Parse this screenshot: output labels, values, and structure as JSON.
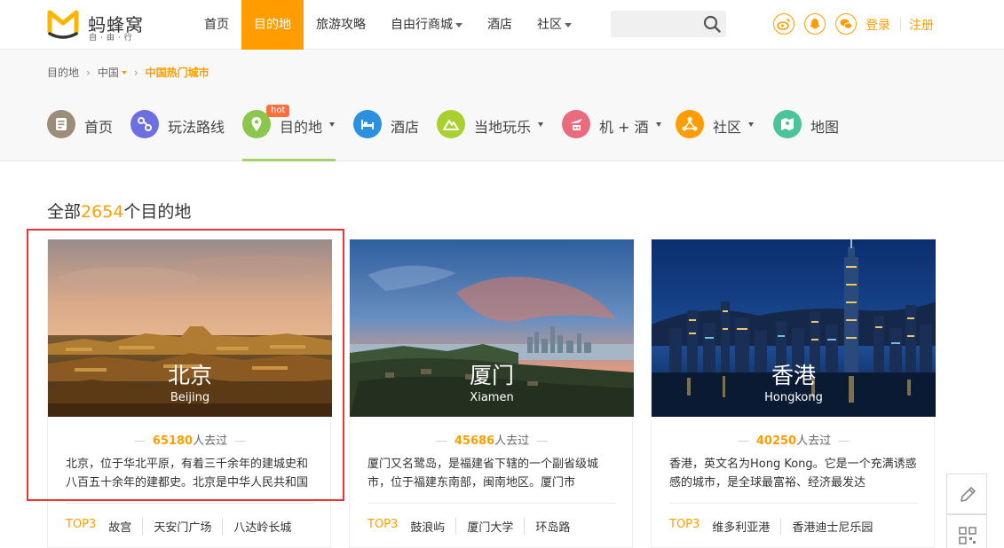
{
  "header": {
    "logo_name": "蚂蜂窝",
    "logo_sub": "自·由·行",
    "nav": [
      {
        "label": "首页",
        "active": false,
        "dropdown": false
      },
      {
        "label": "目的地",
        "active": true,
        "dropdown": false
      },
      {
        "label": "旅游攻略",
        "active": false,
        "dropdown": false
      },
      {
        "label": "自由行商城",
        "active": false,
        "dropdown": true
      },
      {
        "label": "酒店",
        "active": false,
        "dropdown": false
      },
      {
        "label": "社区",
        "active": false,
        "dropdown": true
      }
    ],
    "search_placeholder": "",
    "social_icons": [
      "weibo-icon",
      "qq-icon",
      "wechat-icon"
    ],
    "login": "登录",
    "register": "注册",
    "accent": "#ff9d00"
  },
  "breadcrumb": {
    "items": [
      "目的地",
      "中国",
      "中国热门城市"
    ]
  },
  "subnav": {
    "hot": "hot",
    "items": [
      {
        "label": "首页",
        "color": "#9b8d7a",
        "icon": "home-icon",
        "dropdown": false,
        "active": false
      },
      {
        "label": "玩法路线",
        "color": "#6c6fe0",
        "icon": "route-icon",
        "dropdown": false,
        "active": false
      },
      {
        "label": "目的地",
        "color": "#8ac74c",
        "icon": "location-pin-icon",
        "dropdown": true,
        "active": true
      },
      {
        "label": "酒店",
        "color": "#2b90e0",
        "icon": "bed-icon",
        "dropdown": false,
        "active": false
      },
      {
        "label": "当地玩乐",
        "color": "#a8d12f",
        "icon": "mountain-icon",
        "dropdown": true,
        "active": false
      },
      {
        "label": "机 + 酒",
        "color": "#ea6a7e",
        "icon": "plane-hotel-icon",
        "dropdown": true,
        "active": false
      },
      {
        "label": "社区",
        "color": "#ff9d00",
        "icon": "community-icon",
        "dropdown": true,
        "active": false
      },
      {
        "label": "地图",
        "color": "#4cc49a",
        "icon": "map-icon",
        "dropdown": false,
        "active": false
      }
    ]
  },
  "count": {
    "prefix": "全部",
    "number": "2654",
    "suffix": "个目的地"
  },
  "cards": [
    {
      "city_cn": "北京",
      "city_en": "Beijing",
      "visits": "65180",
      "visits_suffix": "人去过",
      "desc": "北京，位于华北平原，有着三千余年的建城史和八百五十余年的建都史。北京是中华人民共和国的首都",
      "top3_label": "TOP3",
      "top3": [
        "故宫",
        "天安门广场",
        "八达岭长城"
      ]
    },
    {
      "city_cn": "厦门",
      "city_en": "Xiamen",
      "visits": "45686",
      "visits_suffix": "人去过",
      "desc": "厦门又名鹭岛，是福建省下辖的一个副省级城市，位于福建东南部，闽南地区。厦门市",
      "top3_label": "TOP3",
      "top3": [
        "鼓浪屿",
        "厦门大学",
        "环岛路"
      ]
    },
    {
      "city_cn": "香港",
      "city_en": "Hongkong",
      "visits": "40250",
      "visits_suffix": "人去过",
      "desc": "香港，英文名为Hong Kong。它是一个充满诱惑感的城市，是全球最富裕、经济最发达",
      "top3_label": "TOP3",
      "top3": [
        "维多利亚港",
        "香港迪士尼乐园"
      ]
    }
  ],
  "side_tools": [
    "pencil-icon",
    "qr-code-icon"
  ]
}
